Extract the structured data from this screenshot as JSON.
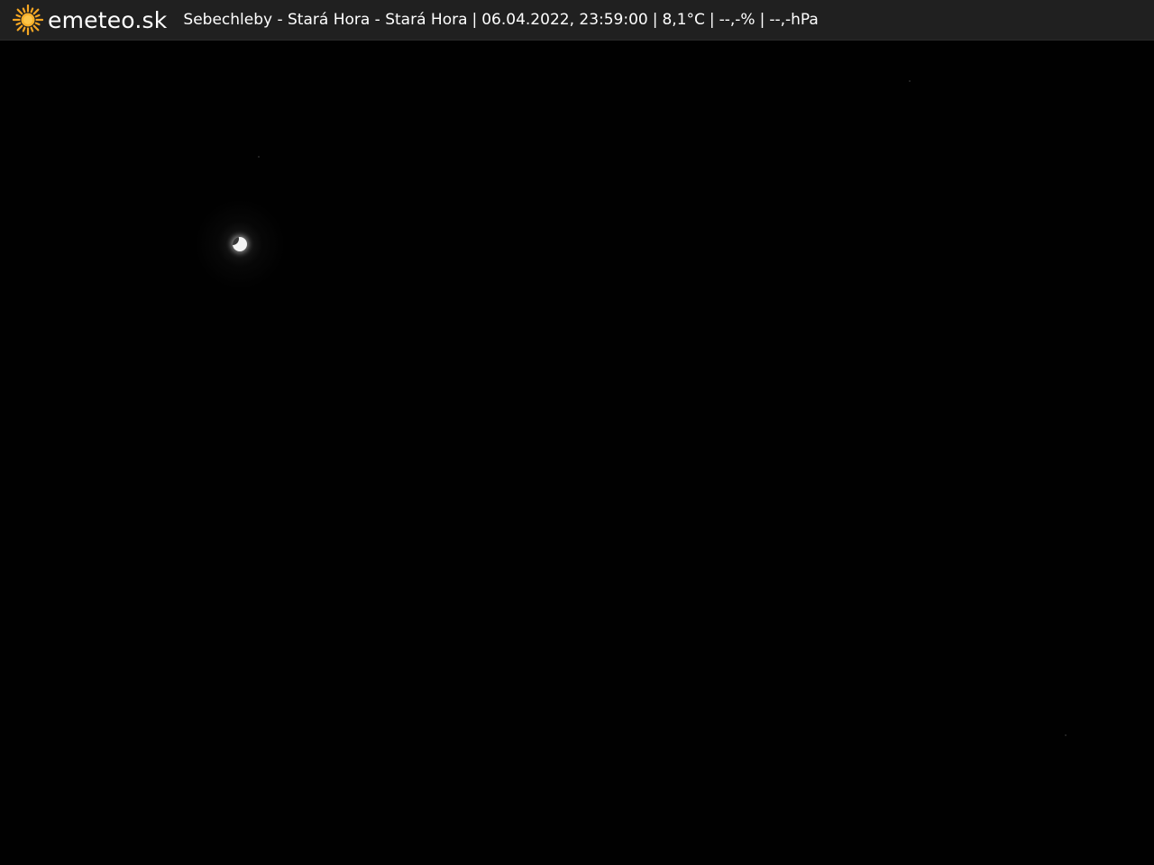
{
  "header": {
    "brand": "emeteo.sk",
    "location": "Sebechleby - Stará Hora - Stará Hora",
    "datetime": "06.04.2022, 23:59:00",
    "temperature": "8,1°C",
    "humidity": "--,-%",
    "pressure": "--,-hPa",
    "separator": "|",
    "logo_icon": "sun-icon"
  },
  "colors": {
    "bar_background": "#202020",
    "sun": "#f5a623",
    "scene": "#010101"
  },
  "scene": {
    "subject": "moon-icon"
  }
}
